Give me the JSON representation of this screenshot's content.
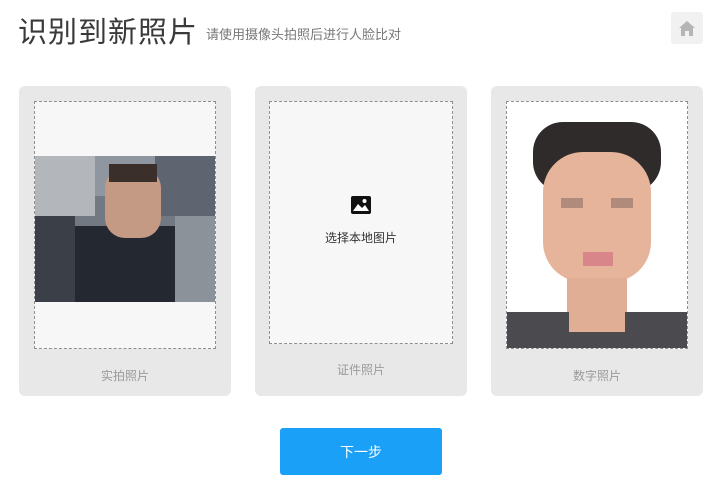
{
  "header": {
    "title": "识别到新照片",
    "subtitle": "请使用摄像头拍照后进行人脸比对",
    "home_icon": "home-icon"
  },
  "cards": {
    "live": {
      "label": "实拍照片"
    },
    "id": {
      "label": "证件照片",
      "upload_text": "选择本地图片",
      "upload_icon": "image-icon"
    },
    "digital": {
      "label": "数字照片"
    }
  },
  "actions": {
    "next_label": "下一步"
  },
  "colors": {
    "primary": "#1aa0f7",
    "card_bg": "#e8e8e8"
  }
}
